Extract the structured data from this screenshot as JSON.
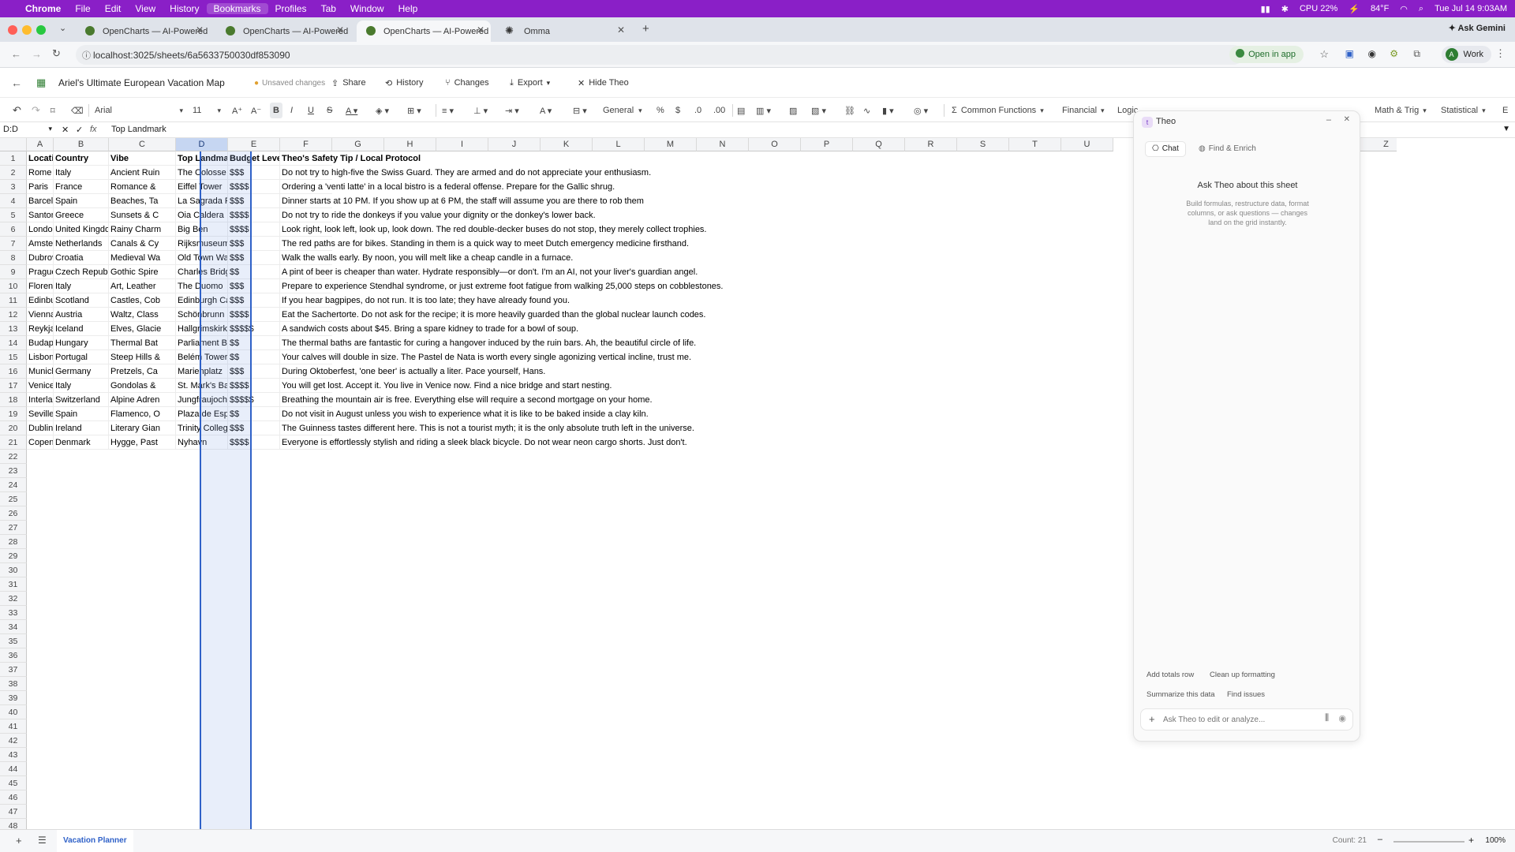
{
  "menubar": {
    "items": [
      "Chrome",
      "File",
      "Edit",
      "View",
      "History",
      "Bookmarks",
      "Profiles",
      "Tab",
      "Window",
      "Help"
    ],
    "cpu": "CPU 22%",
    "weather": "84°F",
    "datetime": "Tue Jul 14  9:03AM"
  },
  "browser": {
    "tabs": [
      {
        "title": "OpenCharts — AI-Powered F"
      },
      {
        "title": "OpenCharts — AI-Powered F"
      },
      {
        "title": "OpenCharts — AI-Powered F"
      },
      {
        "title": "Omma"
      }
    ],
    "ask_gemini": "Ask Gemini",
    "url": "localhost:3025/sheets/6a5633750030df853090",
    "open_in_app": "Open in app",
    "profile": "Work",
    "profile_initial": "A"
  },
  "app": {
    "title": "Ariel's Ultimate European Vacation Map",
    "unsaved": "Unsaved changes",
    "share": "Share",
    "history": "History",
    "changes": "Changes",
    "export": "Export",
    "hide_theo": "Hide Theo"
  },
  "toolbar": {
    "font": "Arial",
    "size": "11",
    "number_format": "General",
    "common_functions": "Common Functions",
    "financial": "Financial",
    "logical": "Logic",
    "math_trig": "Math & Trig",
    "statistical": "Statistical",
    "more": "E"
  },
  "formula_bar": {
    "cell_ref": "D:D",
    "fx": "fx",
    "value": "Top Landmark"
  },
  "sheet": {
    "columns": [
      "A",
      "B",
      "C",
      "D",
      "E",
      "F",
      "G",
      "H",
      "I",
      "J",
      "K",
      "L",
      "M",
      "N",
      "O",
      "P",
      "Q",
      "R",
      "S",
      "T",
      "U",
      "Z"
    ],
    "row_numbers": [
      "1",
      "2",
      "3",
      "4",
      "5",
      "6",
      "7",
      "8",
      "9",
      "10",
      "11",
      "12",
      "13",
      "14",
      "15",
      "16",
      "17",
      "18",
      "19",
      "20",
      "21",
      "22",
      "23",
      "24",
      "25",
      "26",
      "27",
      "28",
      "29",
      "30",
      "31",
      "32",
      "33",
      "34",
      "35",
      "36",
      "37",
      "38",
      "39",
      "40",
      "41",
      "42",
      "43",
      "44",
      "45",
      "46",
      "47",
      "48"
    ],
    "headers": [
      "Location",
      "Country",
      "Vibe",
      "Top Landmark",
      "Budget Level",
      "Theo's Safety Tip / Local Protocol"
    ],
    "rows": [
      [
        "Rome",
        "Italy",
        "Ancient Ruin",
        "The Colosse",
        "$$$",
        "Do not try to high-five the Swiss Guard. They are armed and do not appreciate your enthusiasm."
      ],
      [
        "Paris",
        "France",
        "Romance &",
        "Eiffel Tower",
        "$$$$",
        "Ordering a 'venti latte' in a local bistro is a federal offense. Prepare for the Gallic shrug."
      ],
      [
        "Barcelona",
        "Spain",
        "Beaches, Ta",
        "La Sagrada F",
        "$$$",
        "Dinner starts at 10 PM. If you show up at 6 PM, the staff will assume you are there to rob them"
      ],
      [
        "Santorini",
        "Greece",
        "Sunsets & C",
        "Oia Caldera",
        "$$$$",
        "Do not try to ride the donkeys if you value your dignity or the donkey's lower back."
      ],
      [
        "London",
        "United Kingdom",
        "Rainy Charm",
        "Big Ben",
        "$$$$",
        "Look right, look left, look up, look down. The red double-decker buses do not stop, they merely collect trophies."
      ],
      [
        "Amsterdam",
        "Netherlands",
        "Canals & Cy",
        "Rijksmuseum",
        "$$$",
        "The red paths are for bikes. Standing in them is a quick way to meet Dutch emergency medicine firsthand."
      ],
      [
        "Dubrovnik",
        "Croatia",
        "Medieval Wa",
        "Old Town Wa",
        "$$$",
        "Walk the walls early. By noon, you will melt like a cheap candle in a furnace."
      ],
      [
        "Prague",
        "Czech Republic",
        "Gothic Spire",
        "Charles Bridg",
        "$$",
        "A pint of beer is cheaper than water. Hydrate responsibly—or don't. I'm an AI, not your liver's guardian angel."
      ],
      [
        "Florence",
        "Italy",
        "Art, Leather",
        "The Duomo",
        "$$$",
        "Prepare to experience Stendhal syndrome, or just extreme foot fatigue from walking 25,000 steps on cobblestones."
      ],
      [
        "Edinburgh",
        "Scotland",
        "Castles, Cob",
        "Edinburgh Ca",
        "$$$",
        "If you hear bagpipes, do not run. It is too late; they have already found you."
      ],
      [
        "Vienna",
        "Austria",
        "Waltz, Class",
        "Schönbrunn",
        "$$$$",
        "Eat the Sachertorte. Do not ask for the recipe; it is more heavily guarded than the global nuclear launch codes."
      ],
      [
        "Reykjavik",
        "Iceland",
        "Elves, Glacie",
        "Hallgrimskirk",
        "$$$$$",
        "A sandwich costs about $45. Bring a spare kidney to trade for a bowl of soup."
      ],
      [
        "Budapest",
        "Hungary",
        "Thermal Bat",
        "Parliament B",
        "$$",
        "The thermal baths are fantastic for curing a hangover induced by the ruin bars. Ah, the beautiful circle of life."
      ],
      [
        "Lisbon",
        "Portugal",
        "Steep Hills &",
        "Belém Tower",
        "$$",
        "Your calves will double in size. The Pastel de Nata is worth every single agonizing vertical incline, trust me."
      ],
      [
        "Munich",
        "Germany",
        "Pretzels, Ca",
        "Marienplatz",
        "$$$",
        "During Oktoberfest, 'one beer' is actually a liter. Pace yourself, Hans."
      ],
      [
        "Venice",
        "Italy",
        "Gondolas &",
        "St. Mark's Ba",
        "$$$$",
        "You will get lost. Accept it. You live in Venice now. Find a nice bridge and start nesting."
      ],
      [
        "Interlaken",
        "Switzerland",
        "Alpine Adren",
        "Jungfraujoch",
        "$$$$$",
        "Breathing the mountain air is free. Everything else will require a second mortgage on your home."
      ],
      [
        "Seville",
        "Spain",
        "Flamenco, O",
        "Plaza de Esp",
        "$$",
        "Do not visit in August unless you wish to experience what it is like to be baked inside a clay kiln."
      ],
      [
        "Dublin",
        "Ireland",
        "Literary Gian",
        "Trinity Colleg",
        "$$$",
        "The Guinness tastes different here. This is not a tourist myth; it is the only absolute truth left in the universe."
      ],
      [
        "Copenhagen",
        "Denmark",
        "Hygge, Past",
        "Nyhavn",
        "$$$$",
        "Everyone is effortlessly stylish and riding a sleek black bicycle. Do not wear neon cargo shorts. Just don't."
      ]
    ]
  },
  "theo": {
    "title": "Theo",
    "avatar": "t",
    "tab_chat": "Chat",
    "tab_find": "Find & Enrich",
    "heading": "Ask Theo about this sheet",
    "subtext": "Build formulas, restructure data, format columns, or ask questions — changes land on the grid instantly.",
    "suggestions": [
      "Add totals row",
      "Clean up formatting",
      "Summarize this data",
      "Find issues"
    ],
    "input_placeholder": "Ask Theo to edit or analyze..."
  },
  "status": {
    "sheet_tab": "Vacation Planner",
    "count": "Count: 21",
    "zoom": "100%"
  },
  "colors": {
    "menubar": "#8a1fc7",
    "selection": "#2f61c8",
    "accent_green": "#1f6d2b"
  }
}
